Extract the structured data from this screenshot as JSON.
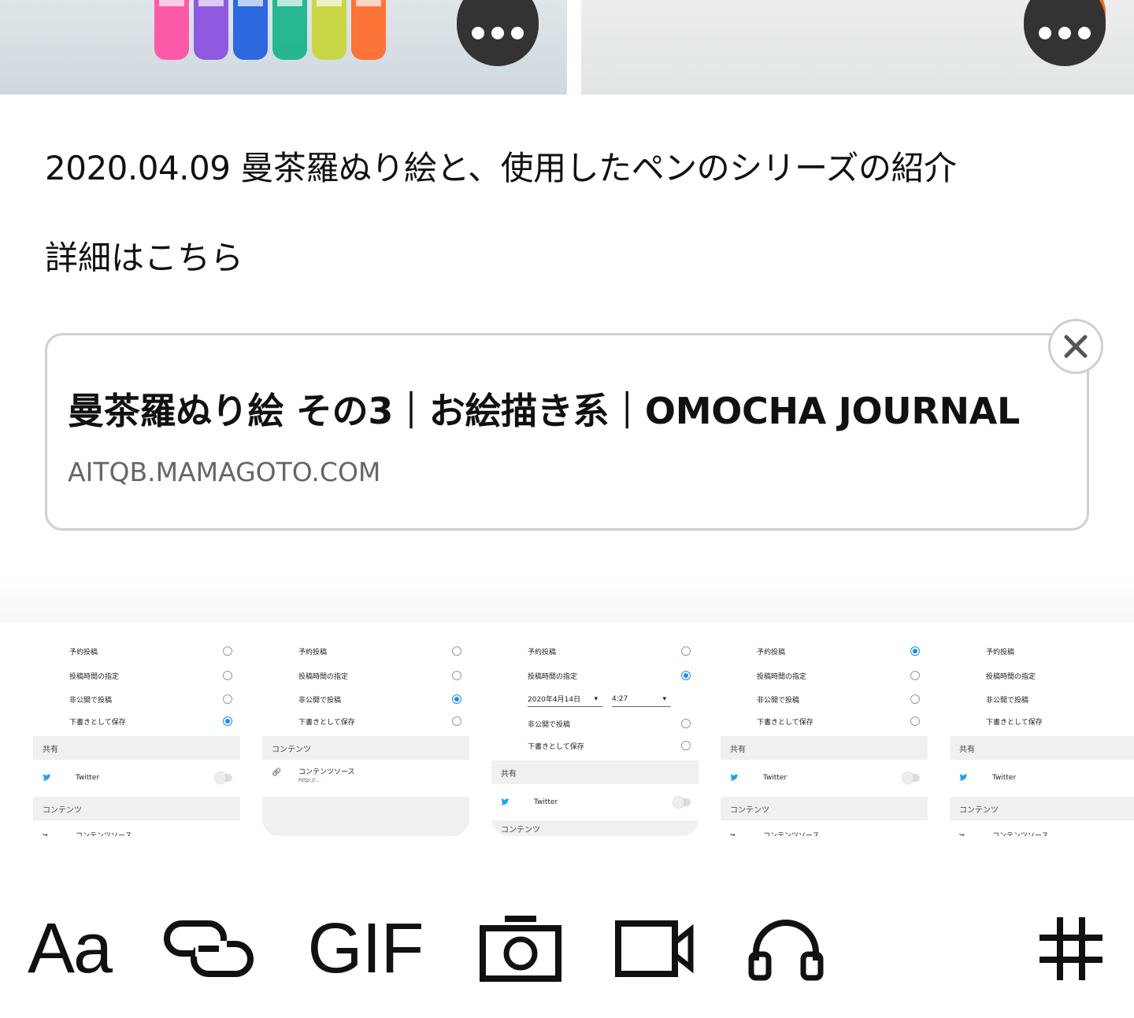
{
  "post": {
    "line": "2020.04.09 曼茶羅ぬり絵と、使用したペンのシリーズの紹介",
    "detail_link": "詳細はこちら"
  },
  "link_card": {
    "title": "曼茶羅ぬり絵 その3｜お絵描き系｜OMOCHA JOURNAL",
    "domain": "AITQB.MAMAGOTO.COM"
  },
  "thumbnails": [
    {
      "options": [
        "予約投稿",
        "投稿時間の指定",
        "非公開で投稿",
        "下書きとして保存"
      ],
      "selected": 3,
      "sections": [
        "共有",
        "コンテンツ"
      ],
      "twitter": "Twitter",
      "content_source": "コンテンツソース"
    },
    {
      "options": [
        "予約投稿",
        "投稿時間の指定",
        "非公開で投稿",
        "下書きとして保存"
      ],
      "selected": 2,
      "sections": [
        "コンテンツ"
      ],
      "content_source": "コンテンツソース",
      "content_source_sub": "http://..."
    },
    {
      "options": [
        "予約投稿",
        "投稿時間の指定",
        "非公開で投稿",
        "下書きとして保存"
      ],
      "selected": 1,
      "date": "2020年4月14日",
      "time": "4:27",
      "sections": [
        "共有",
        "コンテンツ"
      ],
      "twitter": "Twitter"
    },
    {
      "options": [
        "予約投稿",
        "投稿時間の指定",
        "非公開で投稿",
        "下書きとして保存"
      ],
      "selected": 0,
      "sections": [
        "共有",
        "コンテンツ"
      ],
      "twitter": "Twitter",
      "content_source": "コンテンツソース"
    },
    {
      "options": [
        "予約投稿",
        "投稿時間の指定",
        "非公開で投稿",
        "下書きとして保存"
      ],
      "selected": -1,
      "sections": [
        "共有",
        "コンテンツ"
      ],
      "twitter": "Twitter",
      "content_source": "コンテンツソース"
    }
  ],
  "toolbar": {
    "text_label": "Aa",
    "gif_label": "GIF",
    "icons": [
      "text-format-icon",
      "link-icon",
      "gif-icon",
      "camera-icon",
      "video-icon",
      "audio-icon",
      "hashtag-icon"
    ]
  },
  "colors": {
    "accent_blue": "#1a8cff",
    "twitter_blue": "#1da1f2",
    "card_border": "#cfcfcf",
    "more_button": "#333333"
  }
}
